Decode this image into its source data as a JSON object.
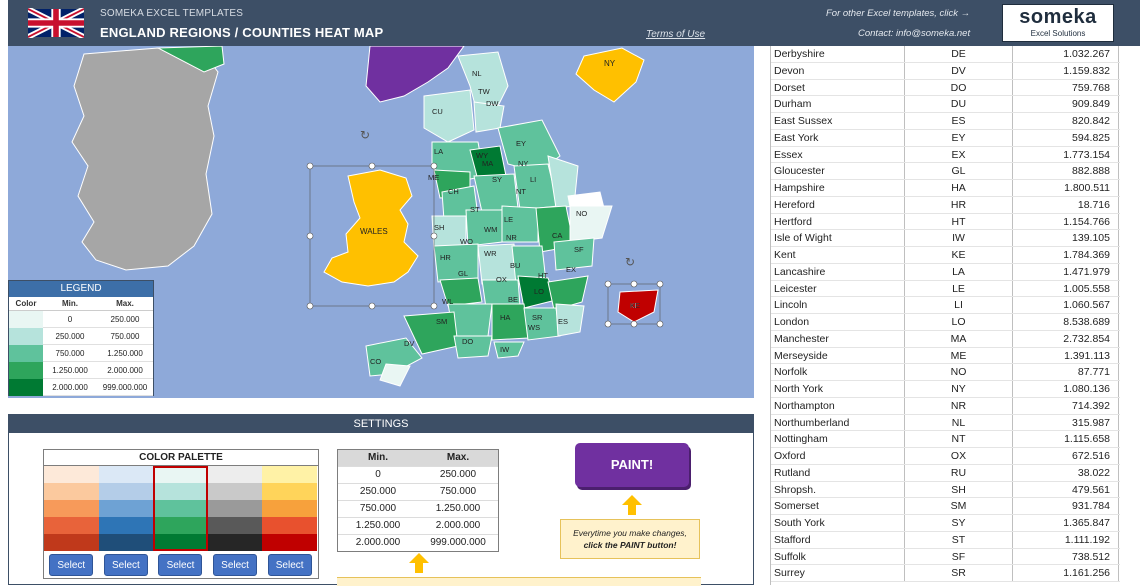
{
  "header": {
    "brand": "SOMEKA EXCEL TEMPLATES",
    "title": "ENGLAND REGIONS / COUNTIES HEAT MAP",
    "terms_link": "Terms of Use",
    "other_templates": "For other Excel templates, click →",
    "contact": "Contact: info@someka.net",
    "logo_name": "someka",
    "logo_sub": "Excel Solutions"
  },
  "colors": {
    "header_bg": "#3d4f66",
    "sea": "#8ea9d9",
    "ireland": "#a6a6a6",
    "wales": "#ffc000",
    "purple": "#7030a0",
    "red": "#c00000",
    "level1": "#e9f6f3",
    "level2": "#b6e3dc",
    "level3": "#5fc29c",
    "level4": "#2ea55c",
    "level5": "#007a33"
  },
  "map": {
    "wales_label": "WALES",
    "labels": [
      "NL",
      "TW",
      "DW",
      "CU",
      "EY",
      "LA",
      "WY",
      "MA",
      "NY",
      "ME",
      "CH",
      "SY",
      "NT",
      "LI",
      "ST",
      "NO",
      "SH",
      "LE",
      "WM",
      "CA",
      "SF",
      "WO",
      "NR",
      "HR",
      "WR",
      "BU",
      "HT",
      "GL",
      "OX",
      "EX",
      "KE",
      "WL",
      "BE",
      "LO",
      "SM",
      "HA",
      "SR",
      "WS",
      "ES",
      "DV",
      "DO",
      "IW",
      "CO"
    ]
  },
  "legend": {
    "title": "LEGEND",
    "col_color": "Color",
    "col_min": "Min.",
    "col_max": "Max.",
    "rows": [
      {
        "min": "0",
        "max": "250.000"
      },
      {
        "min": "250.000",
        "max": "750.000"
      },
      {
        "min": "750.000",
        "max": "1.250.000"
      },
      {
        "min": "1.250.000",
        "max": "2.000.000"
      },
      {
        "min": "2.000.000",
        "max": "999.000.000"
      }
    ]
  },
  "settings": {
    "title": "SETTINGS",
    "palette_title": "COLOR PALETTE",
    "select_label": "Select",
    "selected_palette_index": 2,
    "palettes": [
      [
        "#fde9d9",
        "#fbc99e",
        "#f79a5a",
        "#e8633a",
        "#c0391b"
      ],
      [
        "#dbe8f6",
        "#b4cde8",
        "#6ea2d4",
        "#2e75b6",
        "#1f4e79"
      ],
      [
        "#e9f6f3",
        "#b6e3dc",
        "#5fc29c",
        "#2ea55c",
        "#007a33"
      ],
      [
        "#ededed",
        "#c9c9c9",
        "#9a9a9a",
        "#595959",
        "#262626"
      ],
      [
        "#fff2a6",
        "#ffd45a",
        "#f7a13c",
        "#e8512e",
        "#c00000"
      ]
    ],
    "range_col_min": "Min.",
    "range_col_max": "Max.",
    "ranges": [
      {
        "min": "0",
        "max": "250.000"
      },
      {
        "min": "250.000",
        "max": "750.000"
      },
      {
        "min": "750.000",
        "max": "1.250.000"
      },
      {
        "min": "1.250.000",
        "max": "2.000.000"
      },
      {
        "min": "2.000.000",
        "max": "999.000.000"
      }
    ],
    "paint_label": "PAINT!",
    "note_line1": "Everytime you make changes,",
    "note_line2": "click the PAINT button!"
  },
  "table": {
    "rows": [
      {
        "name": "Derbyshire",
        "code": "DE",
        "value": "1.032.267"
      },
      {
        "name": "Devon",
        "code": "DV",
        "value": "1.159.832"
      },
      {
        "name": "Dorset",
        "code": "DO",
        "value": "759.768"
      },
      {
        "name": "Durham",
        "code": "DU",
        "value": "909.849"
      },
      {
        "name": "East Sussex",
        "code": "ES",
        "value": "820.842"
      },
      {
        "name": "East York",
        "code": "EY",
        "value": "594.825"
      },
      {
        "name": "Essex",
        "code": "EX",
        "value": "1.773.154"
      },
      {
        "name": "Gloucester",
        "code": "GL",
        "value": "882.888"
      },
      {
        "name": "Hampshire",
        "code": "HA",
        "value": "1.800.511"
      },
      {
        "name": "Hereford",
        "code": "HR",
        "value": "18.716"
      },
      {
        "name": "Hertford",
        "code": "HT",
        "value": "1.154.766"
      },
      {
        "name": "Isle of Wight",
        "code": "IW",
        "value": "139.105"
      },
      {
        "name": "Kent",
        "code": "KE",
        "value": "1.784.369"
      },
      {
        "name": "Lancashire",
        "code": "LA",
        "value": "1.471.979"
      },
      {
        "name": "Leicester",
        "code": "LE",
        "value": "1.005.558"
      },
      {
        "name": "Lincoln",
        "code": "LI",
        "value": "1.060.567"
      },
      {
        "name": "London",
        "code": "LO",
        "value": "8.538.689"
      },
      {
        "name": "Manchester",
        "code": "MA",
        "value": "2.732.854"
      },
      {
        "name": "Merseyside",
        "code": "ME",
        "value": "1.391.113"
      },
      {
        "name": "Norfolk",
        "code": "NO",
        "value": "87.771"
      },
      {
        "name": "North York",
        "code": "NY",
        "value": "1.080.136"
      },
      {
        "name": "Northampton",
        "code": "NR",
        "value": "714.392"
      },
      {
        "name": "Northumberland",
        "code": "NL",
        "value": "315.987"
      },
      {
        "name": "Nottingham",
        "code": "NT",
        "value": "1.115.658"
      },
      {
        "name": "Oxford",
        "code": "OX",
        "value": "672.516"
      },
      {
        "name": "Rutland",
        "code": "RU",
        "value": "38.022"
      },
      {
        "name": "Shropsh.",
        "code": "SH",
        "value": "479.561"
      },
      {
        "name": "Somerset",
        "code": "SM",
        "value": "931.784"
      },
      {
        "name": "South York",
        "code": "SY",
        "value": "1.365.847"
      },
      {
        "name": "Stafford",
        "code": "ST",
        "value": "1.111.192"
      },
      {
        "name": "Suffolk",
        "code": "SF",
        "value": "738.512"
      },
      {
        "name": "Surrey",
        "code": "SR",
        "value": "1.161.256"
      }
    ]
  }
}
